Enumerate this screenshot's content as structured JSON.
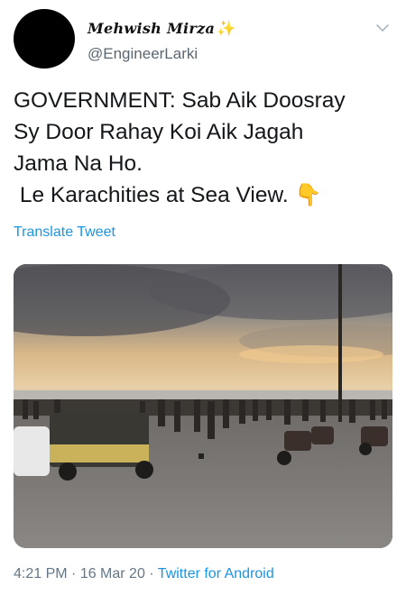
{
  "author": {
    "display_name": "Mehwish Mirza",
    "sparkle_emoji": "✨",
    "handle": "@EngineerLarki"
  },
  "tweet": {
    "text": "GOVERNMENT: Sab Aik Doosray\nSy Door Rahay Koi Aik Jagah\nJama Na Ho.\n Le Karachities at Sea View. ",
    "emoji": "👇",
    "translate_label": "Translate Tweet"
  },
  "meta": {
    "time": "4:21 PM",
    "separator": " · ",
    "date": "16 Mar 20",
    "source": "Twitter for Android"
  },
  "icons": {
    "menu_caret": "chevron-down-icon"
  },
  "colors": {
    "link": "#1b95e0",
    "secondary_text": "#657786",
    "text": "#14171a"
  }
}
